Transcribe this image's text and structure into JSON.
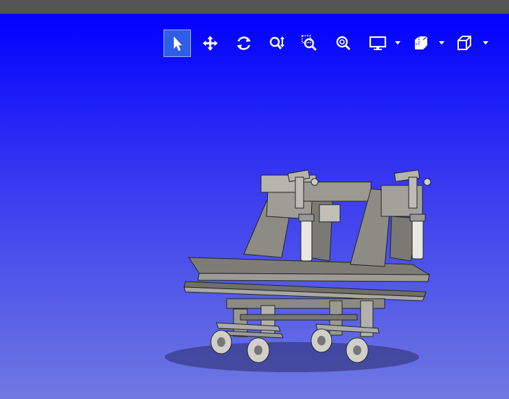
{
  "window": {
    "titlebar_color": "#555555"
  },
  "viewport": {
    "gradient_top": "#0000ff",
    "gradient_bottom": "#6e7ae0"
  },
  "toolbar": {
    "tools": [
      {
        "name": "select-tool",
        "icon": "pointer-icon",
        "active": true
      },
      {
        "name": "pan-tool",
        "icon": "move-arrows-icon"
      },
      {
        "name": "rotate-tool",
        "icon": "rotate-icon"
      },
      {
        "name": "zoom-tool",
        "icon": "zoom-vertical-icon"
      },
      {
        "name": "zoom-window-tool",
        "icon": "zoom-window-icon"
      },
      {
        "name": "zoom-fit-tool",
        "icon": "zoom-fit-icon"
      },
      {
        "name": "display-mode-tool",
        "icon": "monitor-icon",
        "dropdown": true
      },
      {
        "name": "section-tool",
        "icon": "section-box-icon",
        "dropdown": true
      },
      {
        "name": "view-orientation-tool",
        "icon": "cube-icon",
        "dropdown": true
      }
    ]
  },
  "scene": {
    "object": "cart-fixture-3d-model",
    "model_color": "#8c8c84",
    "shadow_color": "#202050"
  }
}
